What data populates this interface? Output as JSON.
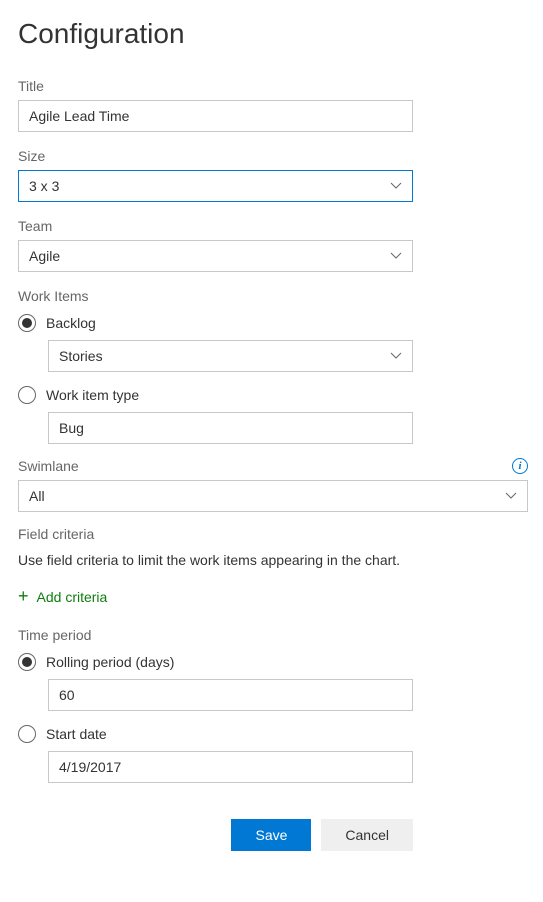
{
  "heading": "Configuration",
  "title": {
    "label": "Title",
    "value": "Agile Lead Time"
  },
  "size": {
    "label": "Size",
    "value": "3 x 3"
  },
  "team": {
    "label": "Team",
    "value": "Agile"
  },
  "workItems": {
    "label": "Work Items",
    "backlogOption": "Backlog",
    "backlogValue": "Stories",
    "typeOption": "Work item type",
    "typeValue": "Bug"
  },
  "swimlane": {
    "label": "Swimlane",
    "value": "All"
  },
  "fieldCriteria": {
    "label": "Field criteria",
    "helper": "Use field criteria to limit the work items appearing in the chart.",
    "addLabel": "Add criteria"
  },
  "timePeriod": {
    "label": "Time period",
    "rollingOption": "Rolling period (days)",
    "rollingValue": "60",
    "startDateOption": "Start date",
    "startDateValue": "4/19/2017"
  },
  "buttons": {
    "save": "Save",
    "cancel": "Cancel"
  }
}
